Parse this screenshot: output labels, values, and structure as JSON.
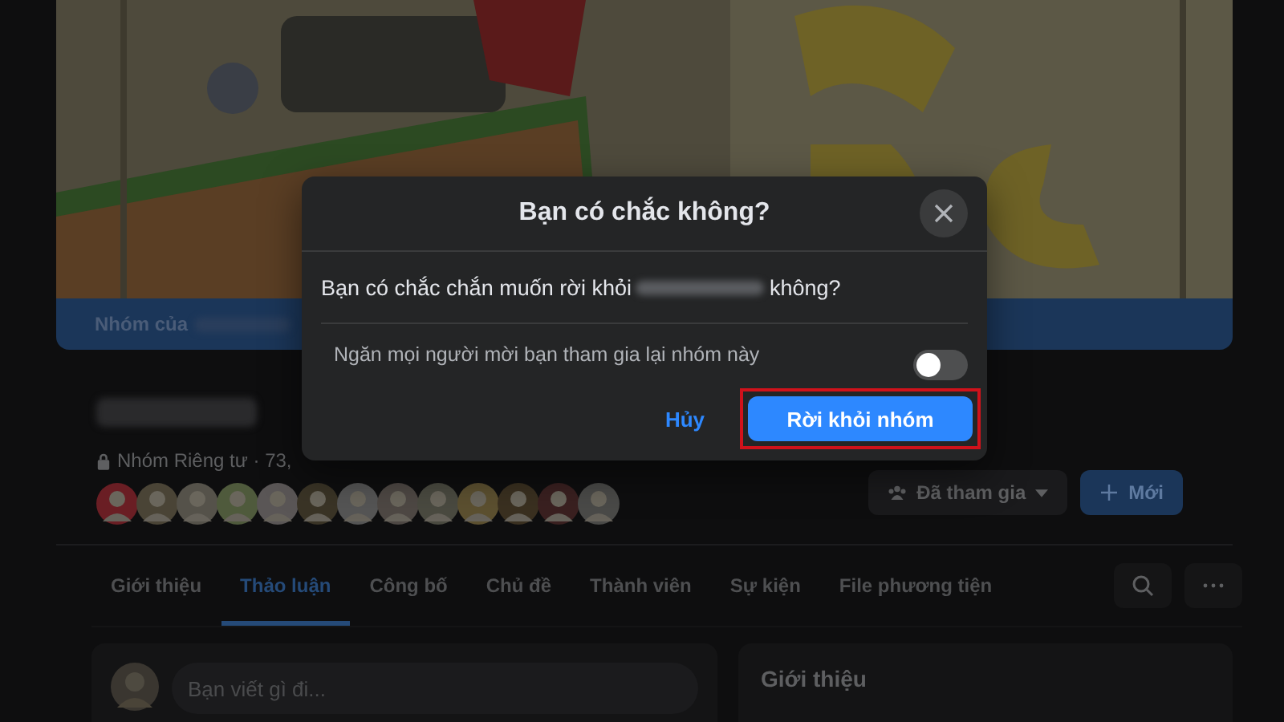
{
  "group_banner": {
    "label": "Nhóm của"
  },
  "group": {
    "privacy": "Nhóm Riêng tư · 73,"
  },
  "joined_button": {
    "label": "Đã tham gia"
  },
  "new_button": {
    "label": "Mới"
  },
  "tabs": [
    {
      "label": "Giới thiệu",
      "selected": false
    },
    {
      "label": "Thảo luận",
      "selected": true
    },
    {
      "label": "Công bố",
      "selected": false
    },
    {
      "label": "Chủ đề",
      "selected": false
    },
    {
      "label": "Thành viên",
      "selected": false
    },
    {
      "label": "Sự kiện",
      "selected": false
    },
    {
      "label": "File phương tiện",
      "selected": false
    }
  ],
  "composer": {
    "placeholder": "Bạn viết gì đi..."
  },
  "about": {
    "title": "Giới thiệu"
  },
  "dialog": {
    "title": "Bạn có chắc không?",
    "message_before": "Bạn có chắc chắn muốn rời khỏi",
    "message_after": "không?",
    "option": {
      "label": "Ngăn mọi người mời bạn tham gia lại nhóm này",
      "on": false
    },
    "cancel": "Hủy",
    "confirm": "Rời khỏi nhóm",
    "confirm_highlighted": true
  }
}
